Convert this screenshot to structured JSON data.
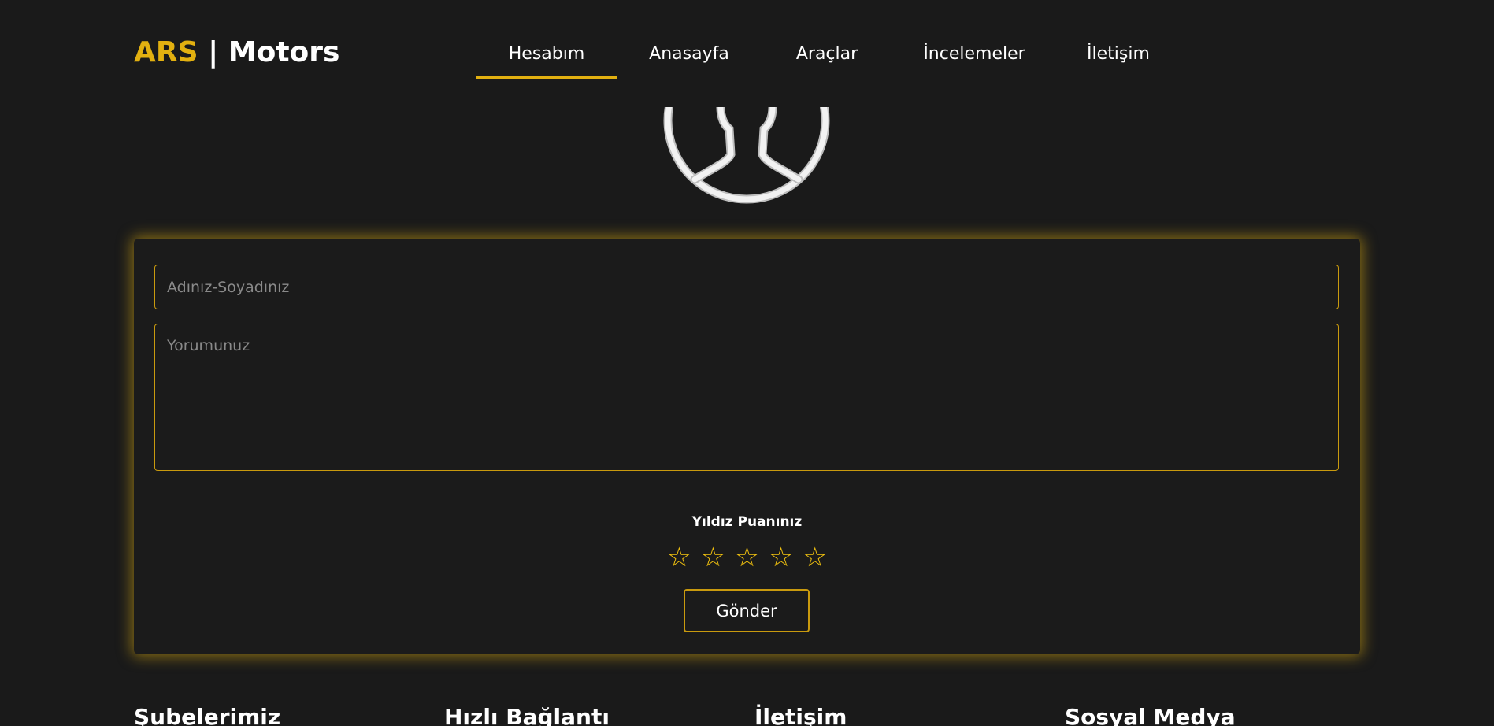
{
  "header": {
    "logo_brand": "ARS",
    "logo_separator": "|",
    "logo_rest": "Motors"
  },
  "nav": {
    "items": [
      {
        "label": "Hesabım",
        "active": true
      },
      {
        "label": "Anasayfa",
        "active": false
      },
      {
        "label": "Araçlar",
        "active": false
      },
      {
        "label": "İncelemeler",
        "active": false
      },
      {
        "label": "İletişim",
        "active": false
      }
    ]
  },
  "avatar": {
    "icon": "user-avatar-icon"
  },
  "form": {
    "name_placeholder": "Adınız-Soyadınız",
    "name_value": "",
    "comment_placeholder": "Yorumunuz",
    "comment_value": "",
    "rating_label": "Yıldız Puanınız",
    "star_glyph": "☆",
    "rating_max": 5,
    "rating_value": 0,
    "submit_label": "Gönder"
  },
  "footer": {
    "columns": [
      "Şubelerimiz",
      "Hızlı Bağlantı",
      "İletişim",
      "Sosyal Medya"
    ]
  },
  "colors": {
    "background": "#1a1a1a",
    "accent": "#e2b010",
    "star": "#f2c20f",
    "text": "#ffffff",
    "placeholder": "#8a8a8a"
  }
}
